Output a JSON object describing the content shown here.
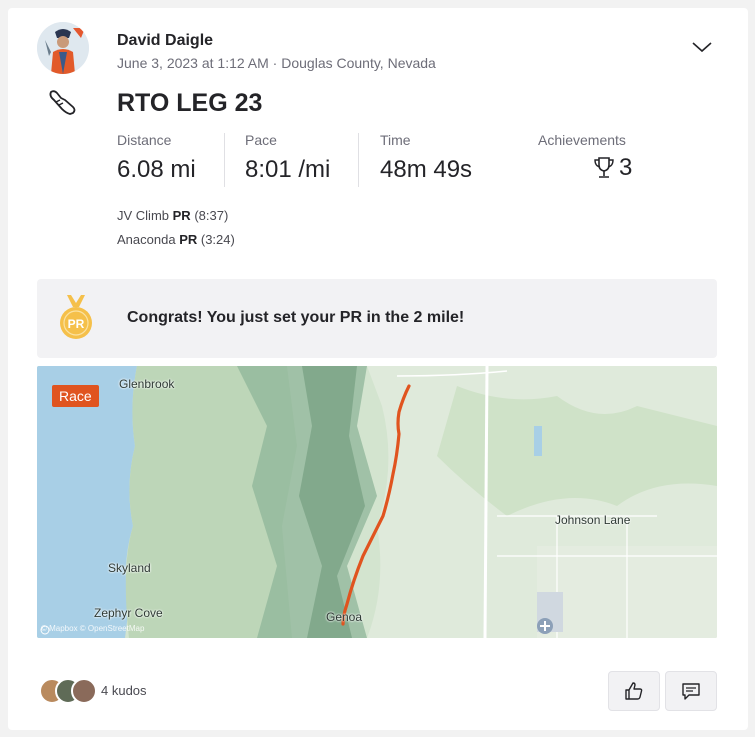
{
  "athlete": {
    "name": "David Daigle",
    "date": "June 3, 2023 at 1:12 AM",
    "location": "Douglas County, Nevada",
    "separator": "·"
  },
  "activity": {
    "title": "RTO LEG 23",
    "sport_icon": "running-shoe-icon",
    "stats": [
      {
        "label": "Distance",
        "value": "6.08 mi"
      },
      {
        "label": "Pace",
        "value": "8:01 /mi"
      },
      {
        "label": "Time",
        "value": "48m 49s"
      }
    ],
    "achievements": {
      "label": "Achievements",
      "count": "3",
      "icon": "trophy-icon"
    },
    "segments": [
      {
        "name": "JV Climb",
        "badge": "PR",
        "time": "(8:37)"
      },
      {
        "name": "Anaconda",
        "badge": "PR",
        "time": "(3:24)"
      }
    ]
  },
  "banner": {
    "message": "Congrats! You just set your PR in the 2 mile!",
    "medal_text": "PR",
    "medal_color": "#f5c04a"
  },
  "map": {
    "badge": "Race",
    "badge_color": "#e0541f",
    "route_color": "#e0541f",
    "places": [
      "Glenbrook",
      "Skyland",
      "Zephyr Cove",
      "Genoa",
      "Johnson Lane"
    ],
    "attribution": "© Mapbox © OpenStreetMap"
  },
  "social": {
    "kudos_text": "4 kudos",
    "kudos_icon": "thumbs-up-icon",
    "comment_icon": "comment-icon"
  }
}
